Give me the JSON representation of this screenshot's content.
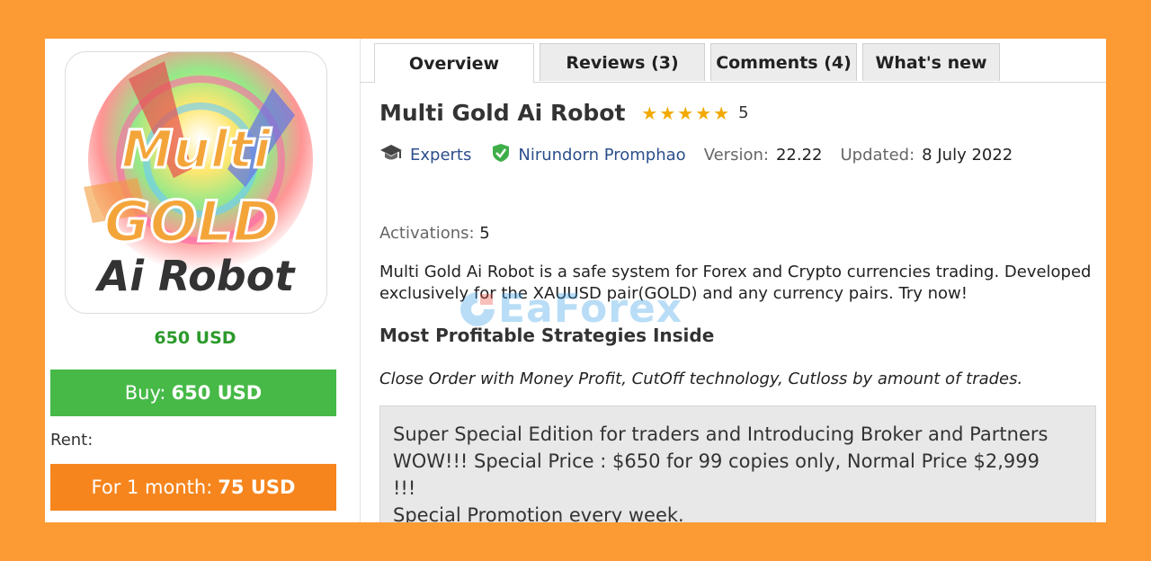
{
  "product": {
    "logo": {
      "line1": "Multi",
      "line2": "GOLD",
      "line3": "Ai Robot"
    },
    "price": "650 USD",
    "buy": {
      "prefix": "Buy:",
      "amount": "650 USD"
    },
    "rent_label": "Rent:",
    "rent": {
      "prefix": "For 1 month:",
      "amount": "75 USD"
    }
  },
  "tabs": [
    {
      "label": "Overview",
      "active": true
    },
    {
      "label": "Reviews (3)",
      "active": false
    },
    {
      "label": "Comments (4)",
      "active": false
    },
    {
      "label": "What's new",
      "active": false
    }
  ],
  "overview": {
    "title": "Multi Gold Ai Robot",
    "stars": "★★★★★",
    "rating": "5",
    "category": "Experts",
    "author": "Nirundorn Promphao",
    "version_label": "Version:",
    "version": "22.22",
    "updated_label": "Updated:",
    "updated": "8 July 2022",
    "activations_label": "Activations:",
    "activations": "5",
    "description": "Multi Gold Ai Robot is a safe system for Forex and Crypto currencies trading. Developed exclusively for the XAUUSD pair(GOLD) and any currency pairs. Try now!",
    "subheading": "Most Profitable Strategies Inside",
    "features": "Close Order with Money Profit, CutOff technology, Cutloss by amount of trades.",
    "promo": {
      "line1": "Super Special Edition for traders and Introducing Broker and Partners",
      "line2": "WOW!!! Special Price : $650 for 99 copies only, Normal Price $2,999\n!!!",
      "line3": "Special Promotion every week."
    }
  },
  "watermark": "EaForex",
  "colors": {
    "frame": "#fc9a34",
    "buy": "#46b947",
    "rent": "#f6851d",
    "price": "#2b9a2b",
    "stars": "#f2a900",
    "link": "#2c4f8c"
  }
}
